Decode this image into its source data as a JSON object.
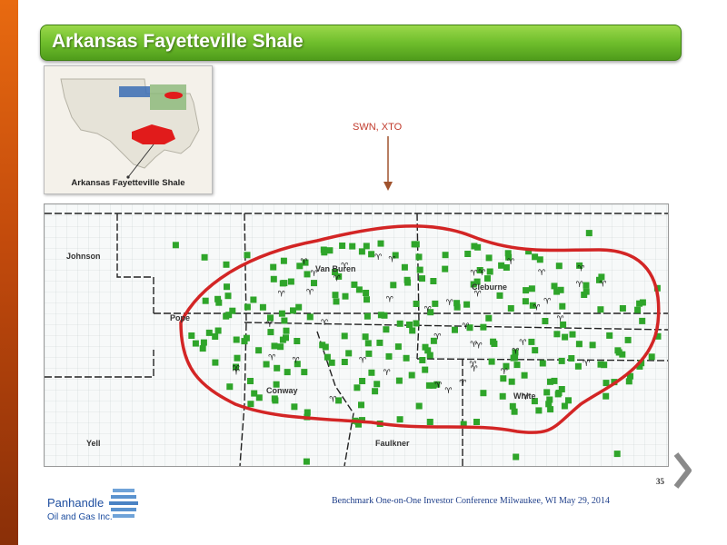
{
  "slide": {
    "title": "Arkansas Fayetteville Shale",
    "inset_caption": "Arkansas Fayetteville Shale",
    "annotation": "SWN, XTO",
    "page_number": "35",
    "footer": "Benchmark One-on-One Investor Conference Milwaukee, WI  May 29, 2014"
  },
  "map": {
    "counties": {
      "johnson": "Johnson",
      "pope": "Pope",
      "van_buren": "Van Buren",
      "cleburne": "Cleburne",
      "conway": "Conway",
      "white": "White",
      "yell": "Yell",
      "faulkner": "Faulkner"
    },
    "colors": {
      "outline": "#d32525",
      "wells": "#2fa52a",
      "rigs": "#111111"
    }
  },
  "logo": {
    "name": "Panhandle",
    "sub": "Oil and Gas Inc."
  }
}
